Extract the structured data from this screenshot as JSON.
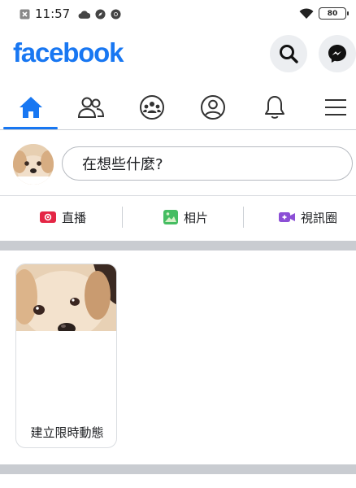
{
  "status_bar": {
    "time": "11:57",
    "battery": "80"
  },
  "header": {
    "logo": "facebook",
    "search_icon": "search-icon",
    "messenger_icon": "messenger-icon",
    "brand_color": "#1877f2"
  },
  "tabs": [
    {
      "icon": "home-icon",
      "active": true
    },
    {
      "icon": "friends-icon",
      "active": false
    },
    {
      "icon": "groups-icon",
      "active": false
    },
    {
      "icon": "profile-icon",
      "active": false
    },
    {
      "icon": "bell-icon",
      "active": false
    },
    {
      "icon": "menu-icon",
      "active": false
    }
  ],
  "composer": {
    "placeholder": "在想些什麼?"
  },
  "actions": [
    {
      "label": "直播",
      "icon": "live-video-icon",
      "color": "#e42645"
    },
    {
      "label": "相片",
      "icon": "photo-icon",
      "color": "#45bd62"
    },
    {
      "label": "視訊圈",
      "icon": "video-room-icon",
      "color": "#8c4fd6"
    }
  ],
  "stories": {
    "create_label": "建立限時動態"
  }
}
